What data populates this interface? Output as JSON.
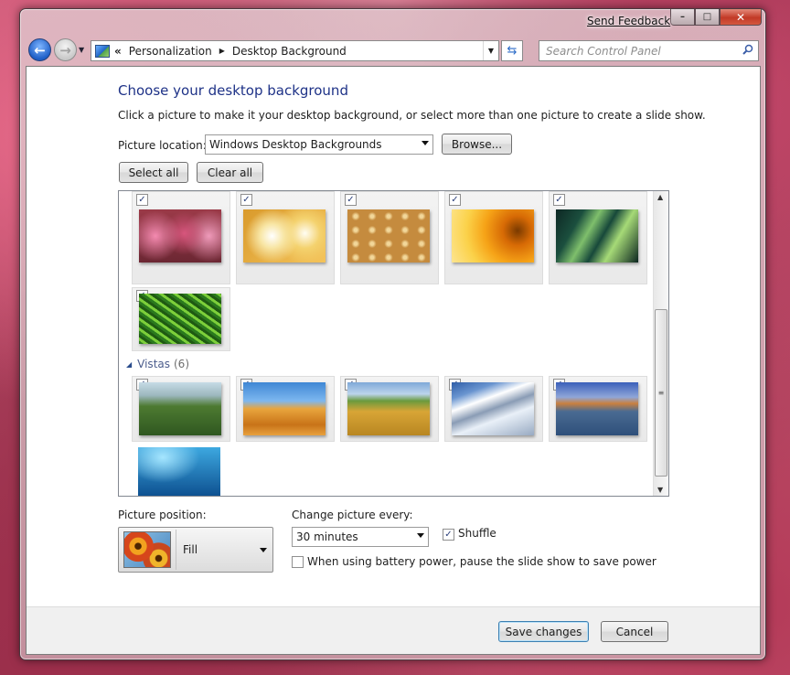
{
  "window": {
    "send_feedback": "Send Feedback",
    "caption_buttons": {
      "minimize": "–",
      "maximize": "□",
      "close": "✕"
    }
  },
  "nav": {
    "breadcrumb_prefix": "«",
    "breadcrumbs": [
      "Personalization",
      "Desktop Background"
    ],
    "search_placeholder": "Search Control Panel"
  },
  "main": {
    "heading": "Choose your desktop background",
    "instruction": "Click a picture to make it your desktop background, or select more than one picture to create a slide show.",
    "picture_location_label": "Picture location:",
    "picture_location_value": "Windows Desktop Backgrounds",
    "browse_label": "Browse...",
    "select_all_label": "Select all",
    "clear_all_label": "Clear all"
  },
  "gallery": {
    "groups": [
      {
        "name": "",
        "items": [
          {
            "name": "pink-dahlia",
            "checked": true
          },
          {
            "name": "frangipani",
            "checked": true
          },
          {
            "name": "golden-pattern",
            "checked": true
          },
          {
            "name": "orange-flower",
            "checked": true
          },
          {
            "name": "green-leaf",
            "checked": true
          },
          {
            "name": "fern",
            "checked": true
          }
        ]
      },
      {
        "name": "Vistas",
        "count": "(6)",
        "items": [
          {
            "name": "waterfall",
            "checked": true
          },
          {
            "name": "sand-dune",
            "checked": true
          },
          {
            "name": "wheat-field",
            "checked": true
          },
          {
            "name": "snowy-mountains",
            "checked": true
          },
          {
            "name": "mountain-lake",
            "checked": true
          },
          {
            "name": "underwater",
            "checked": false
          }
        ]
      }
    ],
    "scroll_position": 0.5
  },
  "settings": {
    "picture_position_label": "Picture position:",
    "picture_position_value": "Fill",
    "change_picture_label": "Change picture every:",
    "change_picture_value": "30 minutes",
    "shuffle_label": "Shuffle",
    "shuffle_checked": true,
    "battery_label": "When using battery power, pause the slide show to save power",
    "battery_checked": false
  },
  "footer": {
    "save_label": "Save changes",
    "cancel_label": "Cancel"
  },
  "check_glyph": "✓"
}
